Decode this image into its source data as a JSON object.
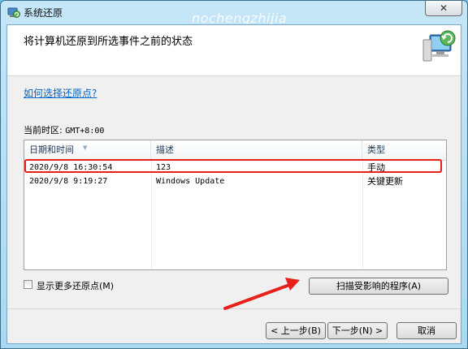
{
  "window": {
    "title": "系统还原",
    "watermark": "nochengzhijia",
    "close_glyph": "✕"
  },
  "header": {
    "heading": "将计算机还原到所选事件之前的状态"
  },
  "help_link": "如何选择还原点?",
  "timezone": {
    "label": "当前时区:",
    "value": "GMT+8:00"
  },
  "table": {
    "columns": [
      "日期和时间",
      "描述",
      "类型"
    ],
    "rows": [
      {
        "datetime": "2020/9/8 16:30:54",
        "description": "123",
        "type": "手动"
      },
      {
        "datetime": "2020/9/8 9:19:27",
        "description": "Windows Update",
        "type": "关键更新"
      }
    ]
  },
  "show_more_label": "显示更多还原点(M)",
  "buttons": {
    "scan": "扫描受影响的程序(A)",
    "back": "< 上一步(B)",
    "next": "下一步(N) >",
    "cancel": "取消"
  },
  "colors": {
    "highlight": "#e8201c",
    "link": "#0066cc",
    "arrow": "#e8201c"
  },
  "icons": {
    "app": "system-restore-icon",
    "header": "computer-restore-icon",
    "annotation": "red-arrow-icon"
  }
}
